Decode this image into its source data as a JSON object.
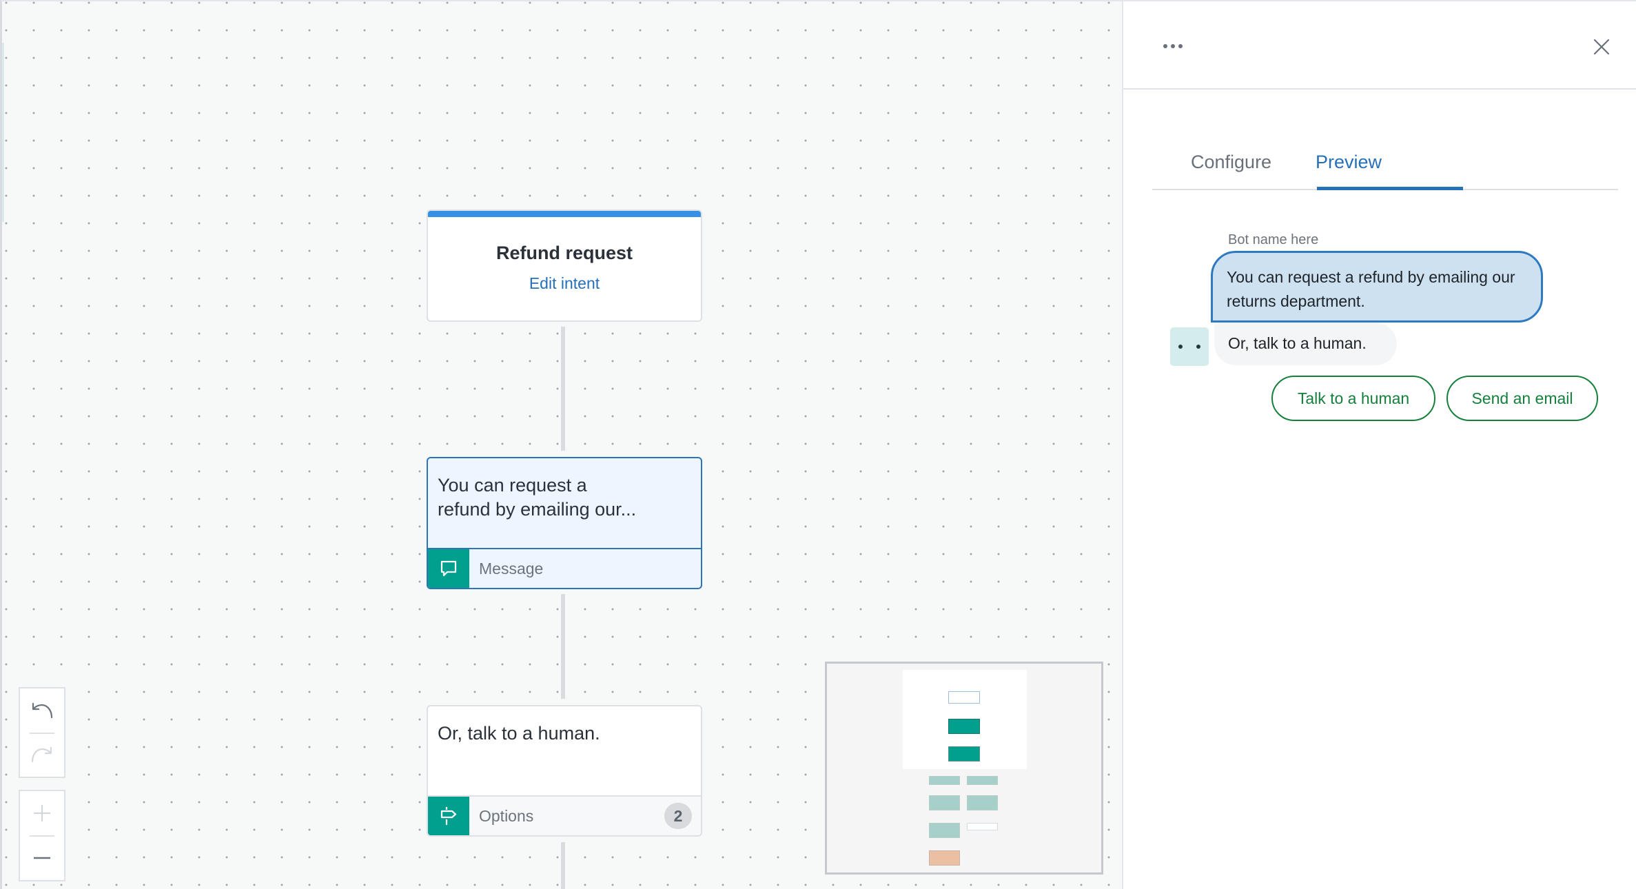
{
  "canvas": {
    "nodes": [
      {
        "type": "intent",
        "title": "Refund request",
        "link": "Edit intent"
      },
      {
        "type": "message",
        "text_line1": "You can request a",
        "text_line2": "refund by emailing our...",
        "footer_label": "Message",
        "icon": "speech-bubble-icon"
      },
      {
        "type": "options",
        "text": "Or, talk to a human.",
        "footer_label": "Options",
        "badge": "2",
        "icon": "signpost-icon"
      }
    ],
    "toolbar": {
      "undo_icon": "undo-icon",
      "redo_icon": "redo-icon",
      "zoom_in_icon": "plus-icon",
      "zoom_out_icon": "minus-icon"
    }
  },
  "panel": {
    "more_icon": "ellipsis-icon",
    "close_icon": "close-icon",
    "tabs": [
      {
        "label": "Configure",
        "active": false
      },
      {
        "label": "Preview",
        "active": true
      }
    ],
    "preview": {
      "bot_name": "Bot name here",
      "messages": [
        "You can request a refund by emailing our returns department.",
        "Or, talk to a human."
      ],
      "quick_replies": [
        "Talk to a human",
        "Send an email"
      ]
    }
  },
  "colors": {
    "accent_blue": "#2670b8",
    "intent_bar": "#3590e6",
    "teal": "#01a08e",
    "quick_reply_green": "#14803c"
  }
}
